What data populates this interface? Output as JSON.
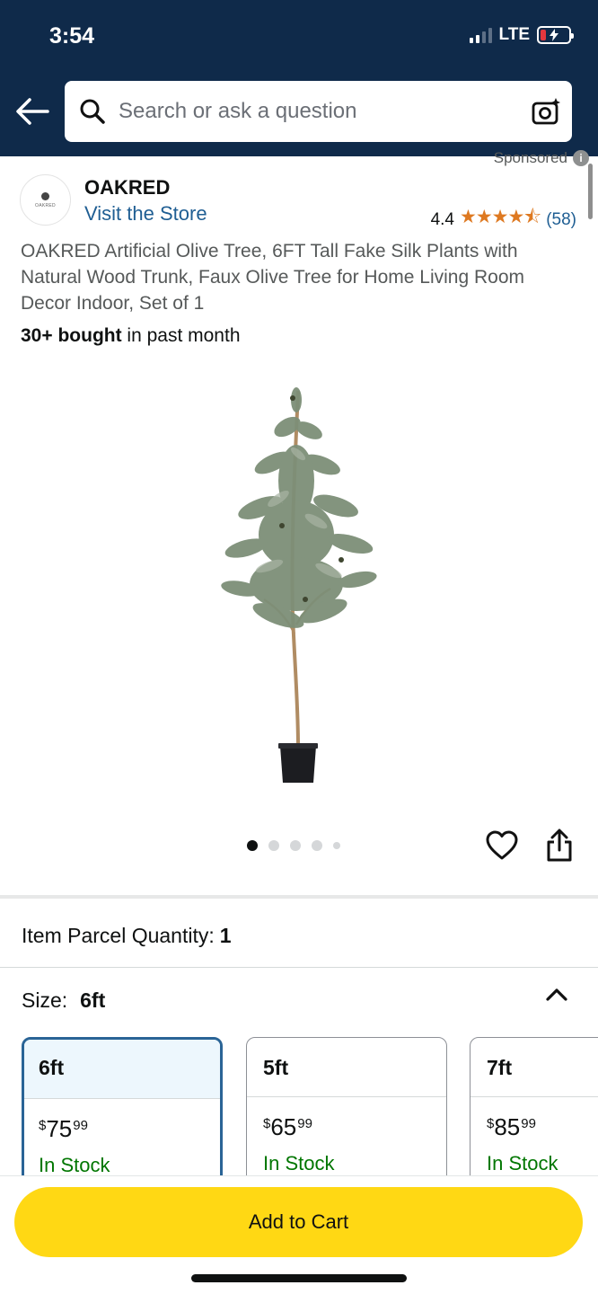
{
  "status_bar": {
    "time": "3:54",
    "network": "LTE"
  },
  "header": {
    "search_placeholder": "Search or ask a question",
    "icons": [
      "back-arrow-icon",
      "search-icon",
      "camera-search-icon"
    ]
  },
  "sponsored_label": "Sponsored",
  "brand": {
    "name": "OAKRED",
    "visit_store": "Visit the Store",
    "logo_text": "OAKRED"
  },
  "rating": {
    "value": "4.4",
    "stars": 4.4,
    "count": "(58)"
  },
  "product": {
    "title": "OAKRED Artificial Olive Tree, 6FT Tall Fake Silk Plants with Natural Wood Trunk, Faux Olive Tree for Home Living Room Decor Indoor, Set of 1",
    "bought_bold": "30+ bought",
    "bought_rest": " in past month",
    "image_dots": 5,
    "active_dot": 0
  },
  "parcel": {
    "label": "Item Parcel Quantity:",
    "value": "1"
  },
  "size": {
    "label": "Size:",
    "selected": "6ft",
    "options": [
      {
        "size": "6ft",
        "currency": "$",
        "dollars": "75",
        "cents": "99",
        "stock": "In Stock",
        "selected": true
      },
      {
        "size": "5ft",
        "currency": "$",
        "dollars": "65",
        "cents": "99",
        "stock": "In Stock",
        "selected": false
      },
      {
        "size": "7ft",
        "currency": "$",
        "dollars": "85",
        "cents": "99",
        "stock": "In Stock",
        "selected": false
      }
    ]
  },
  "actions": {
    "add_to_cart": "Add to Cart"
  },
  "colors": {
    "header_bg": "#0f2a4a",
    "link": "#1f5e93",
    "star": "#de7921",
    "in_stock": "#007600",
    "cta": "#ffd814",
    "selected_border": "#2a6496"
  }
}
